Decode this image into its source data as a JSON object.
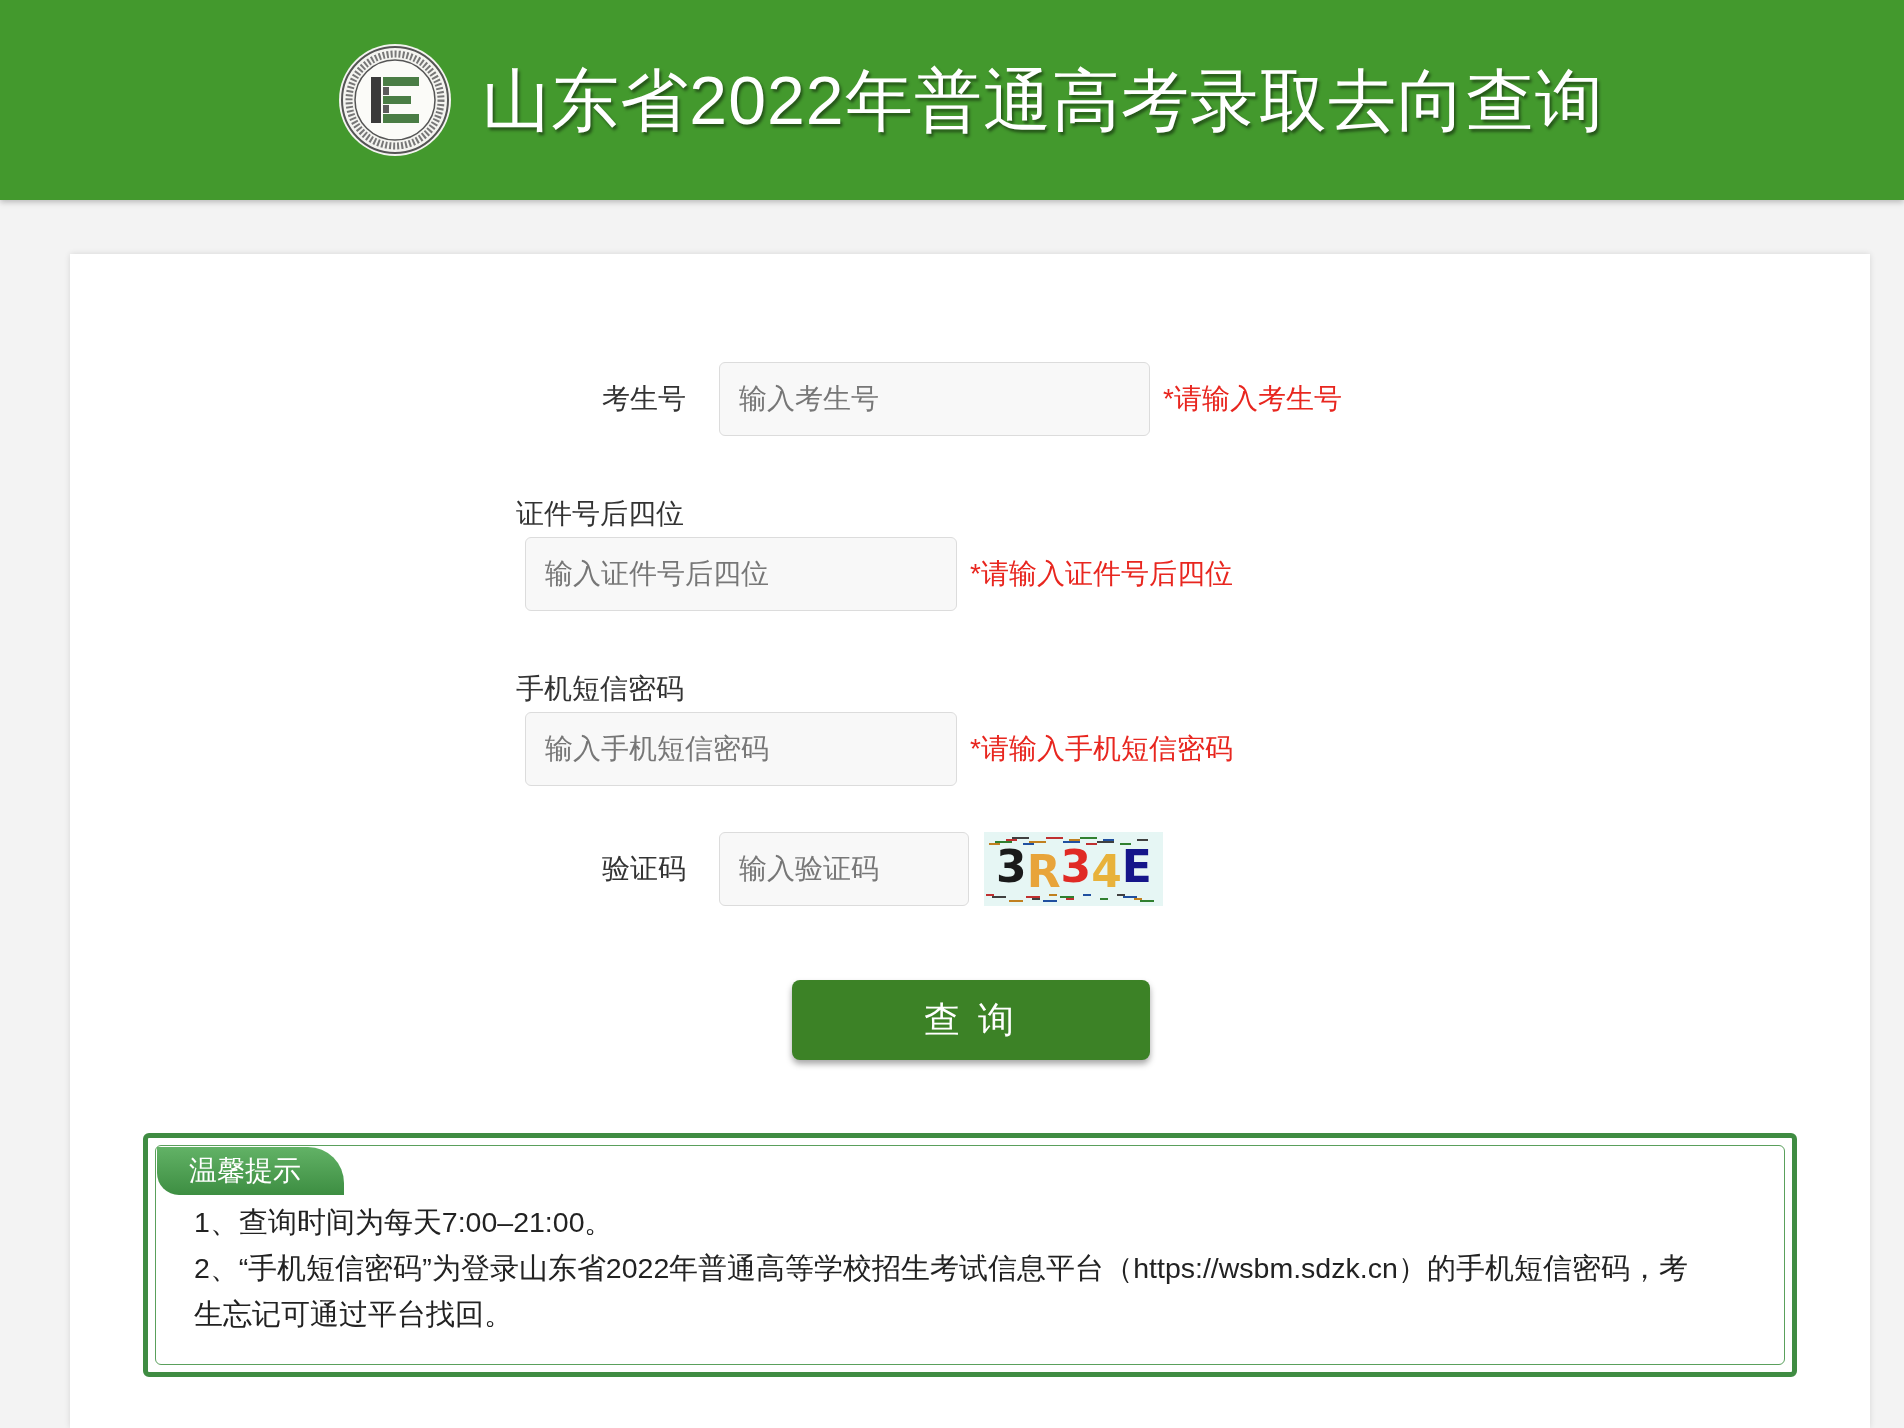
{
  "header": {
    "title": "山东省2022年普通高考录取去向查询"
  },
  "form": {
    "fields": [
      {
        "kind": "inline",
        "label": "考生号",
        "placeholder": "输入考生号",
        "hint": "*请输入考生号"
      },
      {
        "kind": "stacked",
        "label": "证件号后四位",
        "placeholder": "输入证件号后四位",
        "hint": "*请输入证件号后四位"
      },
      {
        "kind": "stacked",
        "label": "手机短信密码",
        "placeholder": "输入手机短信密码",
        "hint": "*请输入手机短信密码"
      },
      {
        "kind": "captcha",
        "label": "验证码",
        "placeholder": "输入验证码",
        "captcha": "3R34E"
      }
    ],
    "submit": "查 询"
  },
  "notice": {
    "title": "温馨提示",
    "items": [
      "1、查询时间为每天7:00–21:00。",
      "2、“手机短信密码”为登录山东省2022年普通高等学校招生考试信息平台（https://wsbm.sdzk.cn）的手机短信密码，考生忘记可通过平台找回。"
    ]
  }
}
